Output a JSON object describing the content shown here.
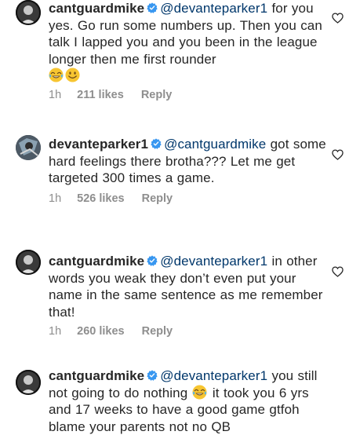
{
  "comments": [
    {
      "username": "cantguardmike",
      "mention": "@devanteparker1",
      "text": " for you yes. Go run some numbers up. Then you can talk I lapped you and you been in the league longer then me first rounder",
      "emojis": [
        "laughing-tears-emoji",
        "smiley-emoji"
      ],
      "time": "1h",
      "likes": "211 likes",
      "reply": "Reply"
    },
    {
      "username": "devanteparker1",
      "mention": "@cantguardmike",
      "text": " got some hard feelings there brotha??? Let me get targeted 300 times a game.",
      "time": "1h",
      "likes": "526 likes",
      "reply": "Reply"
    },
    {
      "username": "cantguardmike",
      "mention": "@devanteparker1",
      "text": " in other words you weak they don’t even put your name in the same sentence as me remember that!",
      "time": "1h",
      "likes": "260 likes",
      "reply": "Reply"
    },
    {
      "username": "cantguardmike",
      "mention": "@devanteparker1",
      "text_before_emoji": " you still not going to do nothing ",
      "emojis": [
        "laughing-tears-emoji"
      ],
      "text_after_emoji": " it took you 6 yrs and 17 weeks to have a good game gtfoh blame your parents not no QB"
    }
  ],
  "colors": {
    "text": "#262626",
    "mention": "#00376b",
    "meta": "#8e8e8e",
    "verified": "#3897f0"
  }
}
